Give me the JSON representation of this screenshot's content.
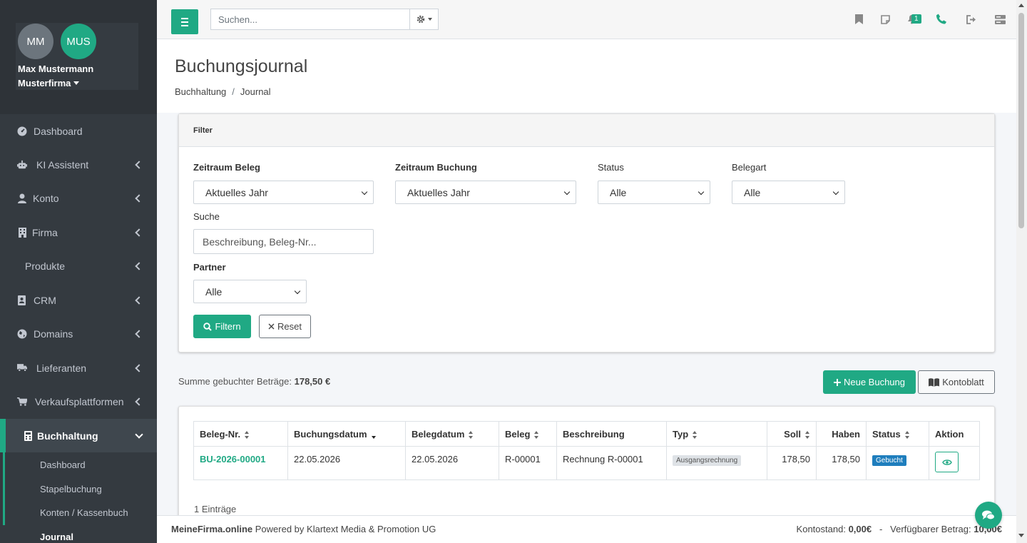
{
  "user": {
    "initials_1": "MM",
    "initials_2": "MUS",
    "name": "Max Mustermann",
    "firm": "Musterfirma"
  },
  "sidebar": {
    "items": [
      {
        "label": "Dashboard",
        "icon": "dashboard-icon"
      },
      {
        "label": "KI Assistent",
        "icon": "robot-icon"
      },
      {
        "label": "Konto",
        "icon": "user-icon"
      },
      {
        "label": "Firma",
        "icon": "building-icon"
      },
      {
        "label": "Produkte",
        "icon": ""
      },
      {
        "label": "CRM",
        "icon": "address-book-icon"
      },
      {
        "label": "Domains",
        "icon": "globe-icon"
      },
      {
        "label": "Lieferanten",
        "icon": "truck-icon"
      },
      {
        "label": "Verkaufsplattformen",
        "icon": "cart-icon"
      },
      {
        "label": "Buchhaltung",
        "icon": "calculator-icon"
      }
    ],
    "subitems": [
      {
        "label": "Dashboard"
      },
      {
        "label": "Stapelbuchung"
      },
      {
        "label": "Konten / Kassenbuch"
      },
      {
        "label": "Journal"
      }
    ]
  },
  "topbar": {
    "search_placeholder": "Suchen...",
    "notification_count": "1"
  },
  "page": {
    "title": "Buchungsjournal",
    "breadcrumb_1": "Buchhaltung",
    "breadcrumb_sep": "/",
    "breadcrumb_2": "Journal"
  },
  "filter": {
    "header": "Filter",
    "zeitraum_beleg_label": "Zeitraum Beleg",
    "zeitraum_beleg_value": "Aktuelles Jahr",
    "zeitraum_buchung_label": "Zeitraum Buchung",
    "zeitraum_buchung_value": "Aktuelles Jahr",
    "status_label": "Status",
    "status_value": "Alle",
    "belegart_label": "Belegart",
    "belegart_value": "Alle",
    "suche_label": "Suche",
    "suche_placeholder": "Beschreibung, Beleg-Nr...",
    "partner_label": "Partner",
    "partner_value": "Alle",
    "filter_button": "Filtern",
    "reset_button": "Reset"
  },
  "summary": {
    "label": "Summe gebuchter Beträge:",
    "value": "178,50 €"
  },
  "actions": {
    "new_booking": "Neue Buchung",
    "kontoblatt": "Kontoblatt"
  },
  "table": {
    "headers": [
      "Beleg-Nr.",
      "Buchungsdatum",
      "Belegdatum",
      "Beleg",
      "Beschreibung",
      "Typ",
      "Soll",
      "Haben",
      "Status",
      "Aktion"
    ],
    "rows": [
      {
        "beleg_nr": "BU-2026-00001",
        "buchungsdatum": "22.05.2026",
        "belegdatum": "22.05.2026",
        "beleg": "R-00001",
        "beschreibung": "Rechnung R-00001",
        "typ": "Ausgangsrechnung",
        "soll": "178,50",
        "haben": "178,50",
        "status": "Gebucht"
      }
    ],
    "entries": "1 Einträge"
  },
  "footer": {
    "brand": "MeineFirma.online",
    "powered": "Powered by Klartext Media & Promotion UG",
    "kontostand_label": "Kontostand:",
    "kontostand_value": "0,00€",
    "sep": "-",
    "verfuegbar_label": "Verfügbarer Betrag:",
    "verfuegbar_value": "10,00€"
  },
  "colors": {
    "accent": "#20a984",
    "sidebar": "#343a40",
    "status_blue": "#1f7ebd"
  }
}
